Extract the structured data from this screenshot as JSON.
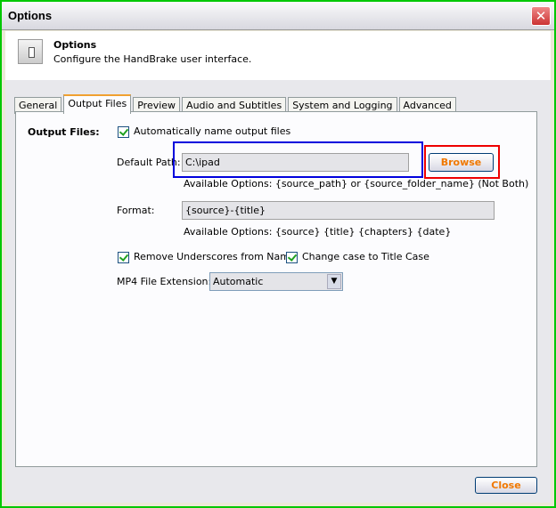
{
  "window": {
    "title": "Options",
    "border_color": "#00c800"
  },
  "header": {
    "title": "Options",
    "subtitle": "Configure the HandBrake user interface."
  },
  "tabs": [
    {
      "label": "General"
    },
    {
      "label": "Output Files",
      "active": true
    },
    {
      "label": "Preview"
    },
    {
      "label": "Audio and Subtitles"
    },
    {
      "label": "System and Logging"
    },
    {
      "label": "Advanced"
    }
  ],
  "output": {
    "section_label": "Output Files:",
    "auto_name_label": "Automatically name output files",
    "auto_name_checked": true,
    "default_path_label": "Default Path:",
    "default_path_value": "C:\\ipad",
    "browse_label": "Browse",
    "path_hint": "Available Options: {source_path} or {source_folder_name} (Not Both)",
    "format_label": "Format:",
    "format_value": "{source}-{title}",
    "format_hint": "Available Options: {source} {title} {chapters} {date}",
    "remove_underscores_label": "Remove Underscores from Name",
    "remove_underscores_checked": true,
    "title_case_label": "Change case to Title Case",
    "title_case_checked": true,
    "mp4_ext_label": "MP4 File Extension:",
    "mp4_ext_value": "Automatic"
  },
  "close_label": "Close",
  "highlights": {
    "path_box_color": "#0000dd",
    "browse_box_color": "#ee0000"
  }
}
